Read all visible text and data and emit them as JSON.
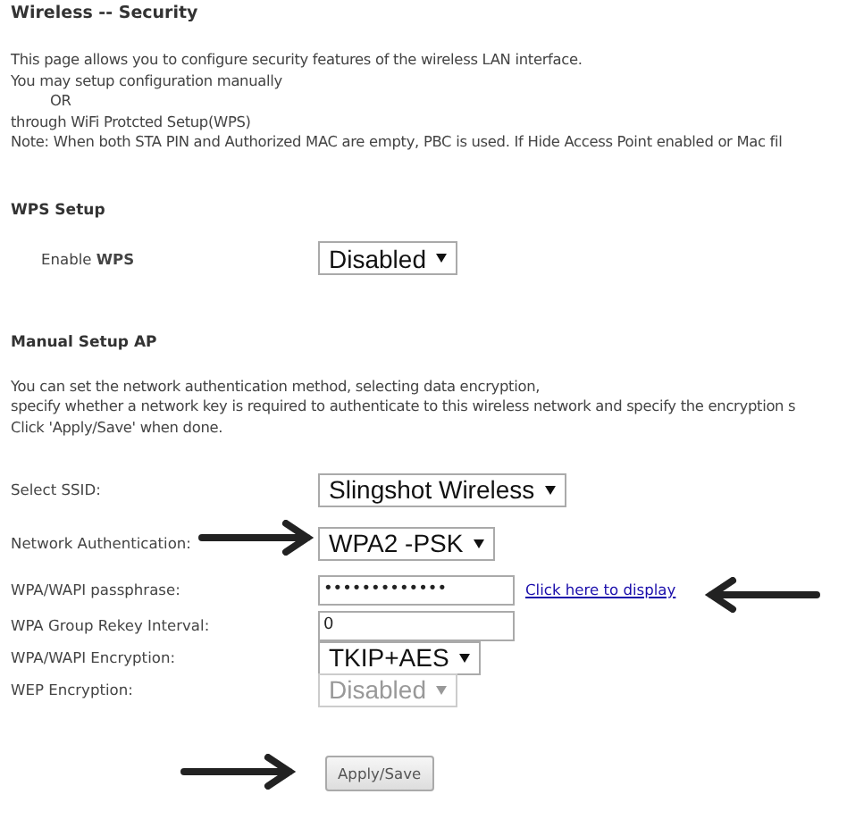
{
  "title": "Wireless -- Security",
  "intro": [
    "This page allows you to configure security features of the wireless LAN interface.",
    "You may setup configuration manually",
    "OR",
    "through WiFi Protcted Setup(WPS)",
    "Note: When both STA PIN and Authorized MAC are empty, PBC is used. If Hide Access Point enabled or Mac fil"
  ],
  "wps": {
    "heading": "WPS Setup",
    "label": "Enable **WPS**",
    "value": "Disabled"
  },
  "manual": {
    "heading": "Manual Setup AP",
    "description": [
      "You can set the network authentication method, selecting data encryption,",
      "specify whether a network key is required to authenticate to this wireless network and specify the encryption s",
      "Click 'Apply/Save' when done."
    ],
    "fields": [
      {
        "kind": "select",
        "label": "Select SSID:",
        "value": "Slingshot Wireless",
        "disabled": false
      },
      {
        "kind": "select",
        "label": "Network Authentication:",
        "value": "WPA2 -PSK",
        "disabled": false
      },
      {
        "kind": "text",
        "label": "WPA/WAPI passphrase:",
        "value": "•••••••••••••",
        "link": "Click here to display"
      },
      {
        "kind": "text",
        "label": "WPA Group Rekey Interval:",
        "value": "0"
      },
      {
        "kind": "select",
        "label": "WPA/WAPI Encryption:",
        "value": "TKIP+AES",
        "disabled": false
      },
      {
        "kind": "select",
        "label": "WEP Encryption:",
        "value": "Disabled",
        "disabled": true
      }
    ]
  },
  "button": "Apply/Save"
}
